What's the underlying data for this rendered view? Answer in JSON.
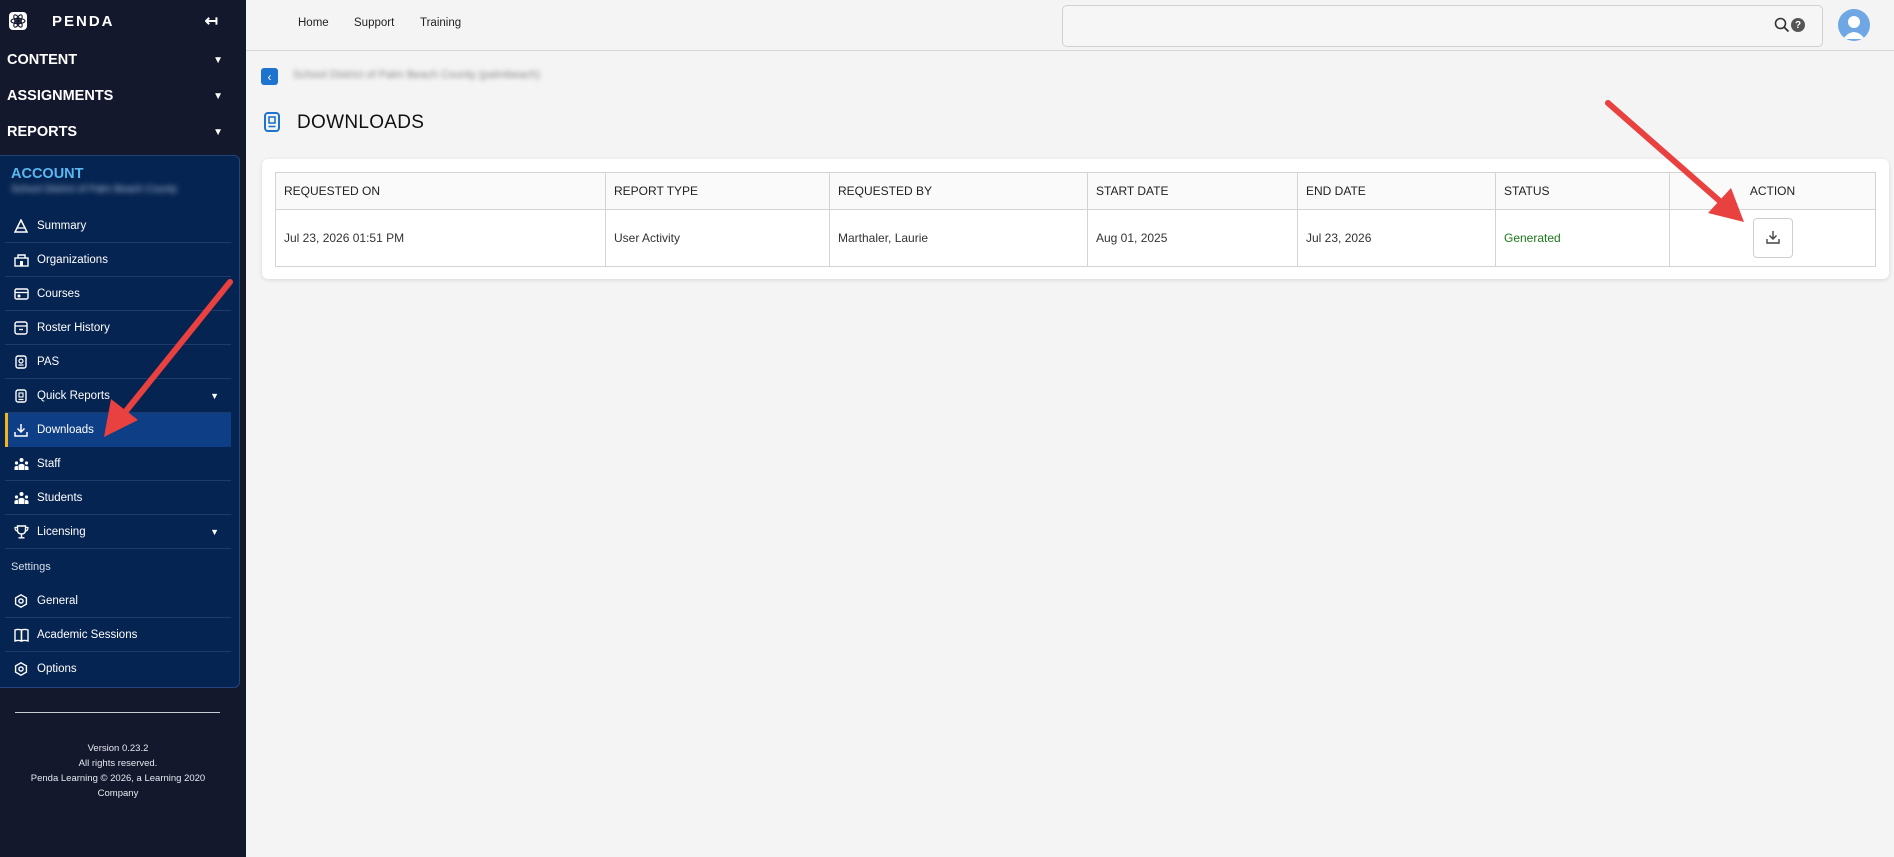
{
  "brand": {
    "name": "PENDA"
  },
  "sidebar": {
    "top_sections": [
      {
        "label": "CONTENT"
      },
      {
        "label": "ASSIGNMENTS"
      },
      {
        "label": "REPORTS"
      }
    ],
    "account": {
      "heading": "ACCOUNT",
      "subtitle": "School District of Palm Beach County"
    },
    "items": [
      {
        "label": "Summary",
        "icon": "summary-icon"
      },
      {
        "label": "Organizations",
        "icon": "organizations-icon"
      },
      {
        "label": "Courses",
        "icon": "courses-icon"
      },
      {
        "label": "Roster History",
        "icon": "roster-history-icon"
      },
      {
        "label": "PAS",
        "icon": "pas-icon"
      },
      {
        "label": "Quick Reports",
        "icon": "quick-reports-icon"
      },
      {
        "label": "Downloads",
        "icon": "download-icon",
        "active": true
      },
      {
        "label": "Staff",
        "icon": "staff-icon"
      },
      {
        "label": "Students",
        "icon": "students-icon"
      },
      {
        "label": "Licensing",
        "icon": "licensing-icon"
      }
    ],
    "settings_label": "Settings",
    "settings_items": [
      {
        "label": "General",
        "icon": "gear-icon"
      },
      {
        "label": "Academic Sessions",
        "icon": "book-icon"
      },
      {
        "label": "Options",
        "icon": "options-gear-icon"
      }
    ],
    "footer": {
      "version": "Version 0.23.2",
      "rights": "All rights reserved.",
      "company": "Penda Learning © 2026, a Learning 2020 Company"
    }
  },
  "header": {
    "links": [
      "Home",
      "Support",
      "Training"
    ],
    "search_placeholder": "",
    "help_glyph": "?"
  },
  "breadcrumb": {
    "text": "School District of Palm Beach County (palmbeach)"
  },
  "page": {
    "title": "DOWNLOADS"
  },
  "table": {
    "columns": [
      "REQUESTED ON",
      "REPORT TYPE",
      "REQUESTED BY",
      "START DATE",
      "END DATE",
      "STATUS",
      "ACTION"
    ],
    "rows": [
      {
        "requested_on": "Jul 23, 2026 01:51 PM",
        "report_type": "User Activity",
        "requested_by": "Marthaler, Laurie",
        "start_date": "Aug 01, 2025",
        "end_date": "Jul 23, 2026",
        "status": "Generated"
      }
    ]
  },
  "colors": {
    "sidebar_bg": "#13182d",
    "account_bg": "#062451",
    "account_heading": "#5ab7f0",
    "active_item_bg": "#0e3f86",
    "active_accent": "#f3b51b",
    "status_generated": "#1b7a1b",
    "annotation_arrow": "#e8413f"
  }
}
